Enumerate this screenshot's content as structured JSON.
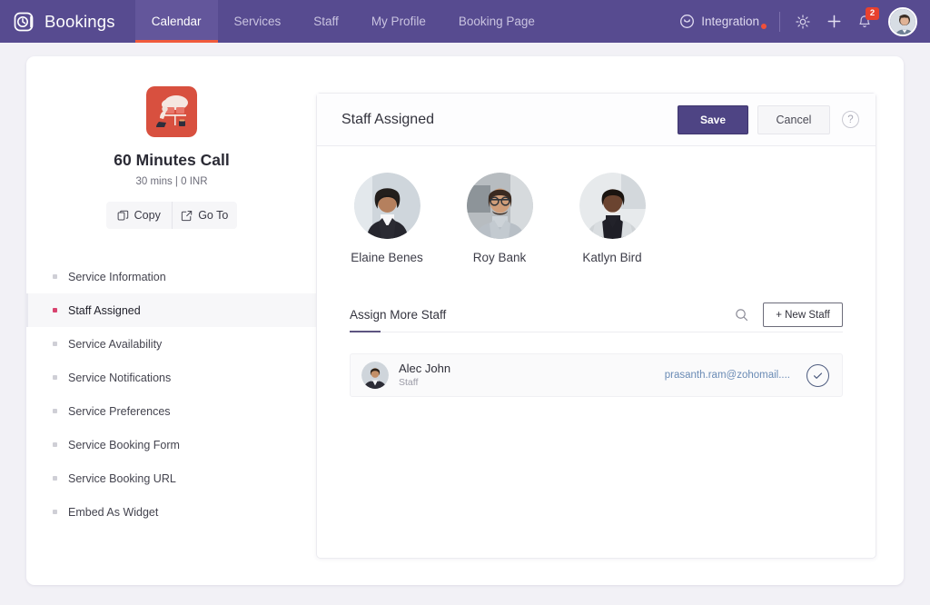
{
  "topnav": {
    "brand": "Bookings",
    "tabs": [
      {
        "label": "Calendar",
        "active": true
      },
      {
        "label": "Services",
        "active": false
      },
      {
        "label": "Staff",
        "active": false
      },
      {
        "label": "My Profile",
        "active": false
      },
      {
        "label": "Booking Page",
        "active": false
      }
    ],
    "integration_label": "Integration",
    "notification_count": "2",
    "colors": {
      "nav_bg": "#574b90",
      "active_tab_bg": "#63569b",
      "active_tab_underline": "#f05a3c",
      "badge": "#e8412e"
    }
  },
  "service": {
    "title": "60 Minutes Call",
    "meta": "30 mins | 0 INR",
    "actions": [
      {
        "label": "Copy",
        "icon": "copy-icon"
      },
      {
        "label": "Go To",
        "icon": "external-link-icon"
      }
    ],
    "nav_items": [
      {
        "label": "Service Information",
        "active": false
      },
      {
        "label": "Staff Assigned",
        "active": true
      },
      {
        "label": "Service Availability",
        "active": false
      },
      {
        "label": "Service Notifications",
        "active": false
      },
      {
        "label": "Service Preferences",
        "active": false
      },
      {
        "label": "Service Booking Form",
        "active": false
      },
      {
        "label": "Service Booking URL",
        "active": false
      },
      {
        "label": "Embed As Widget",
        "active": false
      }
    ],
    "active_bullet_color": "#d8436f"
  },
  "panel": {
    "title": "Staff Assigned",
    "save_label": "Save",
    "cancel_label": "Cancel",
    "help_label": "?",
    "save_color": "#4e4484",
    "assigned_staff": [
      {
        "name": "Elaine Benes"
      },
      {
        "name": "Roy Bank"
      },
      {
        "name": "Katlyn Bird"
      }
    ],
    "assign_more": {
      "label": "Assign More Staff",
      "search_icon": "search-icon",
      "new_staff_label": "+ New Staff"
    },
    "results": [
      {
        "name": "Alec John",
        "role": "Staff",
        "email": "prasanth.ram@zohomail....",
        "selected": true
      }
    ]
  }
}
